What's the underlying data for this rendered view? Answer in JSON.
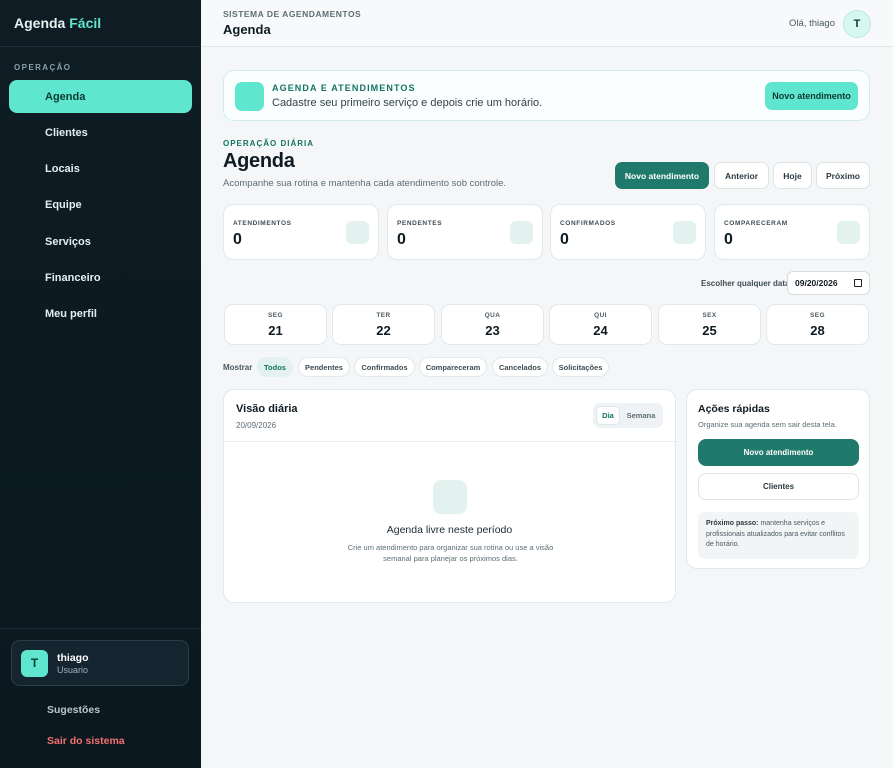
{
  "sidebar": {
    "brand_main": "Agenda",
    "brand_accent": "Fácil",
    "section_label": "OPERAÇÃO",
    "items": [
      {
        "label": "Agenda",
        "active": true
      },
      {
        "label": "Clientes"
      },
      {
        "label": "Locais"
      },
      {
        "label": "Equipe"
      },
      {
        "label": "Serviços"
      },
      {
        "label": "Financeiro"
      },
      {
        "label": "Meu perfil"
      }
    ],
    "user": {
      "initial": "T",
      "name": "thiago",
      "role": "Usuario"
    },
    "suggestions_label": "Sugestões",
    "logout_label": "Sair do sistema"
  },
  "topbar": {
    "kicker": "SISTEMA DE AGENDAMENTOS",
    "title": "Agenda",
    "greeting": "Olá, thiago",
    "avatar_initial": "T"
  },
  "banner": {
    "kicker": "AGENDA E ATENDIMENTOS",
    "text": "Cadastre seu primeiro serviço e depois crie um horário.",
    "button": "Novo atendimento"
  },
  "header": {
    "kicker": "OPERAÇÃO DIÁRIA",
    "title": "Agenda",
    "subtitle": "Acompanhe sua rotina e mantenha cada atendimento sob controle.",
    "buttons": {
      "new": "Novo atendimento",
      "prev": "Anterior",
      "today": "Hoje",
      "next": "Próximo"
    }
  },
  "stats": [
    {
      "label": "ATENDIMENTOS",
      "value": "0"
    },
    {
      "label": "PENDENTES",
      "value": "0"
    },
    {
      "label": "CONFIRMADOS",
      "value": "0"
    },
    {
      "label": "COMPARECERAM",
      "value": "0"
    }
  ],
  "date_picker": {
    "label": "Escolher qualquer data",
    "value": "09/20/2026"
  },
  "days": [
    {
      "name": "SEG",
      "num": "21"
    },
    {
      "name": "TER",
      "num": "22"
    },
    {
      "name": "QUA",
      "num": "23"
    },
    {
      "name": "QUI",
      "num": "24"
    },
    {
      "name": "SEX",
      "num": "25"
    },
    {
      "name": "SEG",
      "num": "28"
    }
  ],
  "filters": {
    "label": "Mostrar",
    "chips": [
      "Todos",
      "Pendentes",
      "Confirmados",
      "Compareceram",
      "Cancelados",
      "Solicitações"
    ]
  },
  "daily": {
    "title": "Visão diária",
    "date": "20/09/2026",
    "seg_day": "Dia",
    "seg_week": "Semana",
    "empty_title": "Agenda livre neste período",
    "empty_text": "Crie um atendimento para organizar sua rotina ou use a visão semanal para planejar os próximos dias."
  },
  "quick": {
    "title": "Ações rápidas",
    "subtitle": "Organize sua agenda sem sair desta tela.",
    "primary": "Novo atendimento",
    "secondary": "Clientes",
    "tip_bold": "Próximo passo:",
    "tip_text": " mantenha serviços e profissionais atualizados para evitar conflitos de horário."
  },
  "colors": {
    "accent": "#5ee6cf",
    "primary": "#1f7a6c",
    "sidebar": "#0f1c24",
    "danger": "#f2716c"
  }
}
